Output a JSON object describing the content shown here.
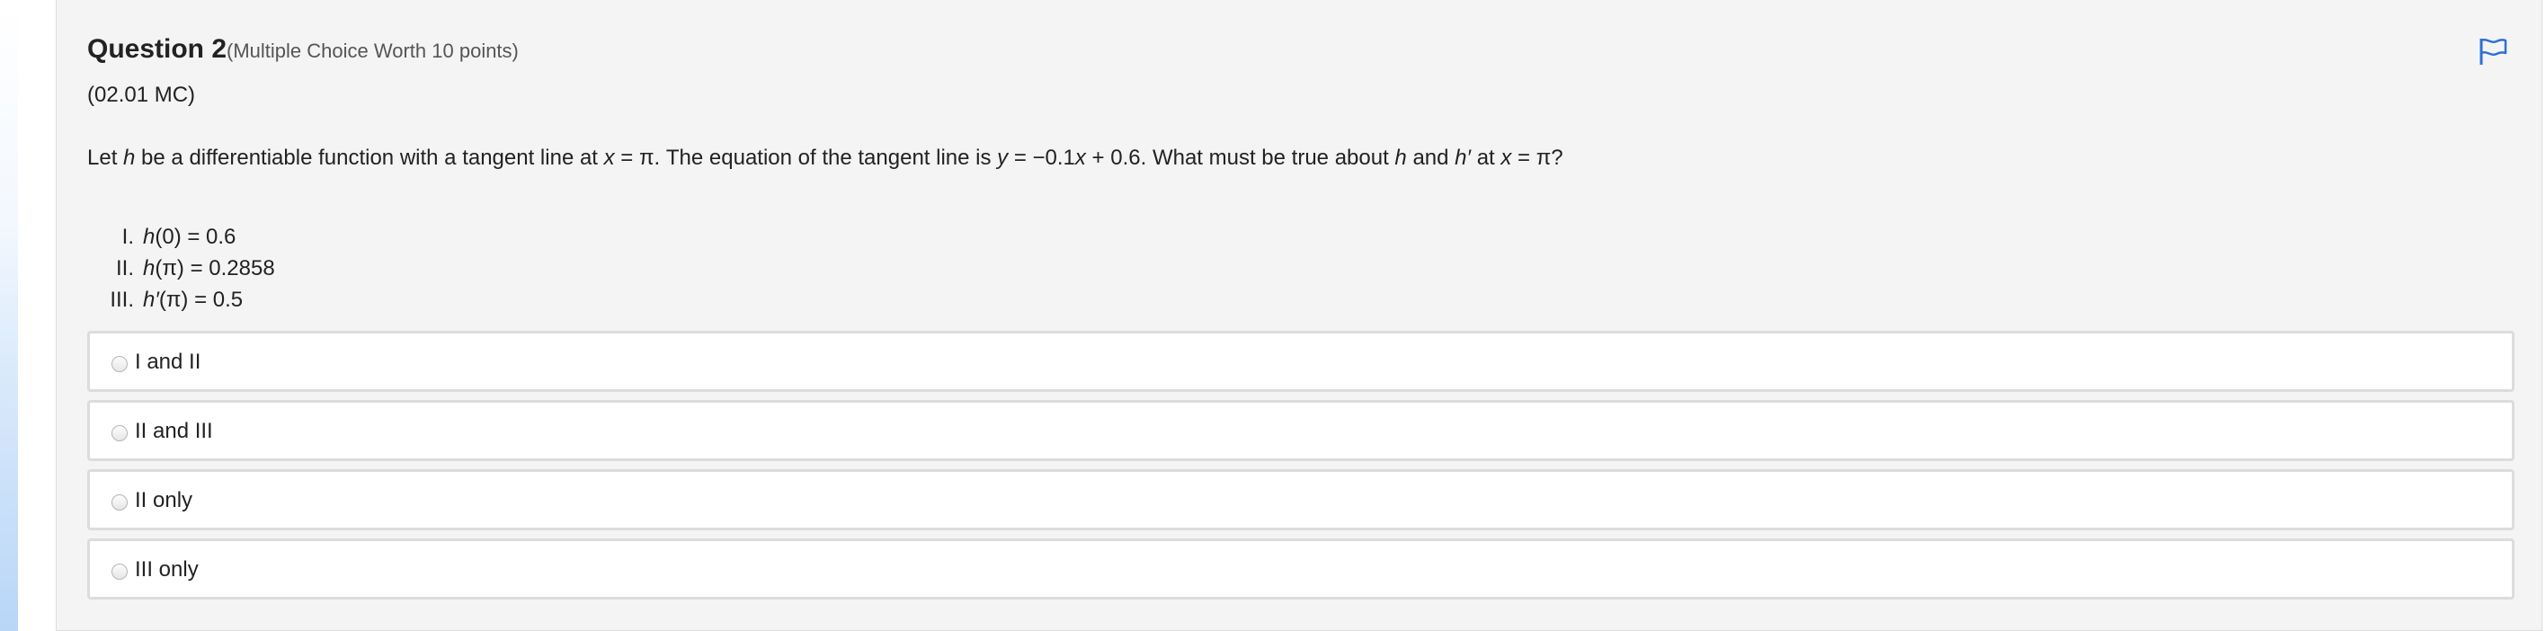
{
  "question": {
    "title": "Question 2",
    "worth": "(Multiple Choice Worth 10 points)",
    "code": "(02.01 MC)",
    "stem": {
      "t1": "Let ",
      "h1": "h",
      "t2": " be a differentiable function with a tangent line at ",
      "x1": "x",
      "t3": " = π. The equation of the tangent line is ",
      "y1": "y",
      "t4": " = −0.1",
      "x2": "x",
      "t5": " + 0.6. What must be true about ",
      "h2": "h",
      "t6": " and ",
      "h3": "h′",
      "t7": " at ",
      "x3": "x",
      "t8": " = π?"
    },
    "statements": [
      {
        "numeral": "I.",
        "fn": "h",
        "expr": "(0) = 0.6"
      },
      {
        "numeral": "II.",
        "fn": "h",
        "expr": "(π) = 0.2858"
      },
      {
        "numeral": "III.",
        "fn": "h′",
        "expr": "(π) = 0.5"
      }
    ],
    "choices": [
      {
        "label": "I and II",
        "selected": false
      },
      {
        "label": "II and III",
        "selected": false
      },
      {
        "label": "II only",
        "selected": false
      },
      {
        "label": "III only",
        "selected": false
      }
    ],
    "flag_icon": "flag-icon",
    "colors": {
      "panel_bg": "#f4f4f4",
      "flag": "#2f6fd6",
      "choice_border": "#dcdcdc"
    }
  }
}
